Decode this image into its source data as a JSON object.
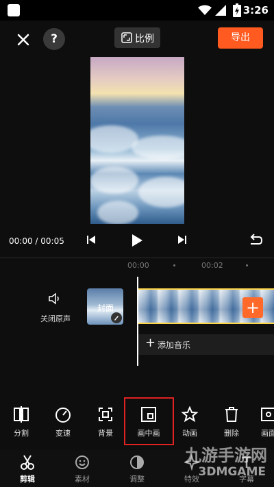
{
  "status_bar": {
    "time": "3:26"
  },
  "toolbar": {
    "ratio_label": "比例",
    "export_label": "导出",
    "help_label": "?"
  },
  "playback": {
    "timecode": "00:00 / 00:05"
  },
  "ruler": {
    "ticks": [
      "00:00",
      "00:02"
    ]
  },
  "track": {
    "audio_label": "关闭原声",
    "cover_label": "封面",
    "add_clip": "+",
    "add_music_label": "添加音乐"
  },
  "tools": [
    {
      "label": "分割",
      "icon": "split-icon"
    },
    {
      "label": "变速",
      "icon": "speed-icon"
    },
    {
      "label": "背景",
      "icon": "background-icon"
    },
    {
      "label": "画中画",
      "icon": "picture-in-picture-icon"
    },
    {
      "label": "动画",
      "icon": "animation-star-icon"
    },
    {
      "label": "删除",
      "icon": "trash-icon"
    },
    {
      "label": "画面",
      "icon": "frame-icon"
    }
  ],
  "nav": [
    {
      "label": "剪辑",
      "icon": "scissors-icon",
      "active": true
    },
    {
      "label": "素材",
      "icon": "sticker-icon"
    },
    {
      "label": "调整",
      "icon": "adjust-icon"
    },
    {
      "label": "特效",
      "icon": "effects-icon"
    },
    {
      "label": "字幕",
      "icon": "text-icon"
    }
  ],
  "watermark": {
    "line1": "九游手游网",
    "line2": "3DMGAME"
  },
  "colors": {
    "accent": "#ff5a1f",
    "highlight": "#e02222",
    "clip_border": "#ffd54a"
  }
}
